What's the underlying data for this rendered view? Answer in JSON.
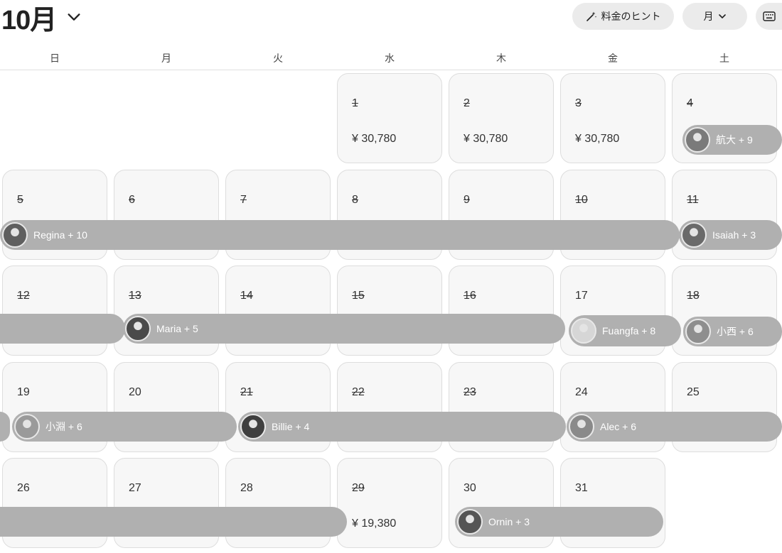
{
  "header": {
    "month_label": "10月",
    "price_hint_label": "料金のヒント",
    "view_label": "月"
  },
  "weekdays": [
    "日",
    "月",
    "火",
    "水",
    "木",
    "金",
    "土"
  ],
  "days": [
    {
      "day": "1",
      "blocked": true,
      "price": "¥ 30,780"
    },
    {
      "day": "2",
      "blocked": true,
      "price": "¥ 30,780"
    },
    {
      "day": "3",
      "blocked": true,
      "price": "¥ 30,780"
    },
    {
      "day": "4",
      "blocked": true,
      "price": ""
    },
    {
      "day": "5",
      "blocked": true,
      "price": ""
    },
    {
      "day": "6",
      "blocked": true,
      "price": ""
    },
    {
      "day": "7",
      "blocked": true,
      "price": ""
    },
    {
      "day": "8",
      "blocked": true,
      "price": ""
    },
    {
      "day": "9",
      "blocked": true,
      "price": ""
    },
    {
      "day": "10",
      "blocked": true,
      "price": ""
    },
    {
      "day": "11",
      "blocked": true,
      "price": ""
    },
    {
      "day": "12",
      "blocked": true,
      "price": ""
    },
    {
      "day": "13",
      "blocked": true,
      "price": ""
    },
    {
      "day": "14",
      "blocked": true,
      "price": ""
    },
    {
      "day": "15",
      "blocked": true,
      "price": ""
    },
    {
      "day": "16",
      "blocked": true,
      "price": ""
    },
    {
      "day": "17",
      "blocked": false,
      "price": ""
    },
    {
      "day": "18",
      "blocked": true,
      "price": ""
    },
    {
      "day": "19",
      "blocked": false,
      "price": ""
    },
    {
      "day": "20",
      "blocked": false,
      "price": ""
    },
    {
      "day": "21",
      "blocked": true,
      "price": ""
    },
    {
      "day": "22",
      "blocked": true,
      "price": ""
    },
    {
      "day": "23",
      "blocked": true,
      "price": ""
    },
    {
      "day": "24",
      "blocked": false,
      "price": ""
    },
    {
      "day": "25",
      "blocked": false,
      "price": ""
    },
    {
      "day": "26",
      "blocked": false,
      "price": ""
    },
    {
      "day": "27",
      "blocked": false,
      "price": ""
    },
    {
      "day": "28",
      "blocked": false,
      "price": ""
    },
    {
      "day": "29",
      "blocked": true,
      "price": "¥ 19,380"
    },
    {
      "day": "30",
      "blocked": false,
      "price": ""
    },
    {
      "day": "31",
      "blocked": false,
      "price": ""
    }
  ],
  "reservations": [
    {
      "guest": "航大 + 9"
    },
    {
      "guest": "Regina + 10"
    },
    {
      "guest": "Isaiah + 3"
    },
    {
      "guest": ""
    },
    {
      "guest": "Maria + 5"
    },
    {
      "guest": "Fuangfa + 8"
    },
    {
      "guest": "小西 + 6"
    },
    {
      "guest": ""
    },
    {
      "guest": "小淵 + 6"
    },
    {
      "guest": "Billie + 4"
    },
    {
      "guest": "Alec + 6"
    },
    {
      "guest": ""
    },
    {
      "guest": "Ornin + 3"
    }
  ]
}
